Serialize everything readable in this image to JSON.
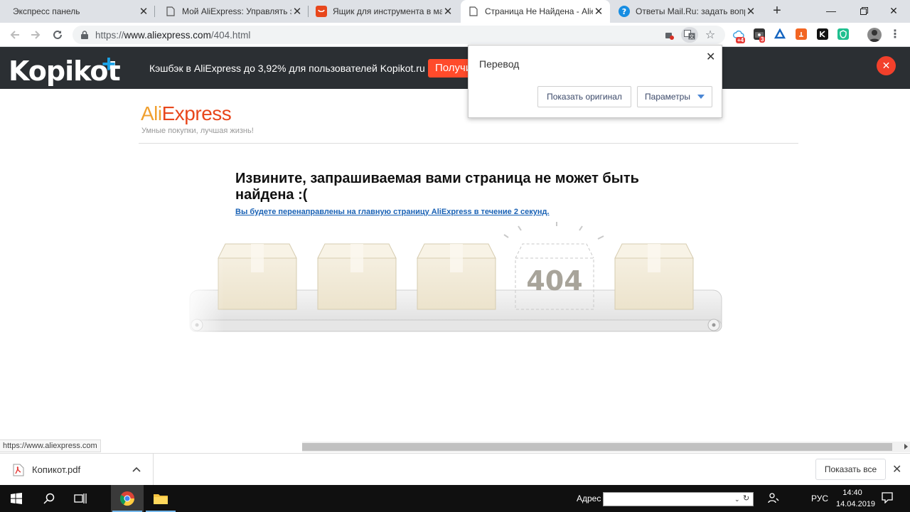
{
  "tabs": [
    {
      "title": "Экспресс панель",
      "active": false,
      "icon": "none"
    },
    {
      "title": "Мой AliExpress: Управлять зак",
      "active": false,
      "icon": "page-icon"
    },
    {
      "title": "Ящик для инструмента в маш",
      "active": false,
      "icon": "aliexpress-icon"
    },
    {
      "title": "Страница Не Найдена - Aliexp",
      "active": true,
      "icon": "page-icon"
    },
    {
      "title": "Ответы Mail.Ru: задать вопро",
      "active": false,
      "icon": "mailru-answers-icon"
    }
  ],
  "toolbar": {
    "url_scheme": "https://",
    "url_host": "www.aliexpress.com",
    "url_path": "/404.html"
  },
  "extensions": {
    "badge_1": "+4",
    "badge_2": "3"
  },
  "kopikot": {
    "logo": "Kopikot",
    "plus": "+",
    "text": "Кэшбэк в AliExpress до 3,92% для пользователей Kopikot.ru",
    "button": "Получить",
    "brand_color": "#1aa3e8",
    "button_color": "#ff4b2b"
  },
  "translate_popup": {
    "title": "Перевод",
    "show_original": "Показать оригинал",
    "options": "Параметры"
  },
  "page": {
    "logo_part1": "Ali",
    "logo_part2": "Express",
    "slogan": "Умные покупки, лучшая жизнь!",
    "heading": "Извините, запрашиваемая вами страница не может быть найдена :(",
    "redirect_link": "Вы будете перенаправлены на главную страницу AliExpress в течение 2 секунд.",
    "illustration_text": "404"
  },
  "status_url": "https://www.aliexpress.com",
  "downloads": {
    "file_name": "Копикот.pdf",
    "show_all": "Показать все"
  },
  "taskbar": {
    "address_label": "Адрес",
    "lang": "РУС",
    "time": "14:40",
    "date": "14.04.2019"
  }
}
